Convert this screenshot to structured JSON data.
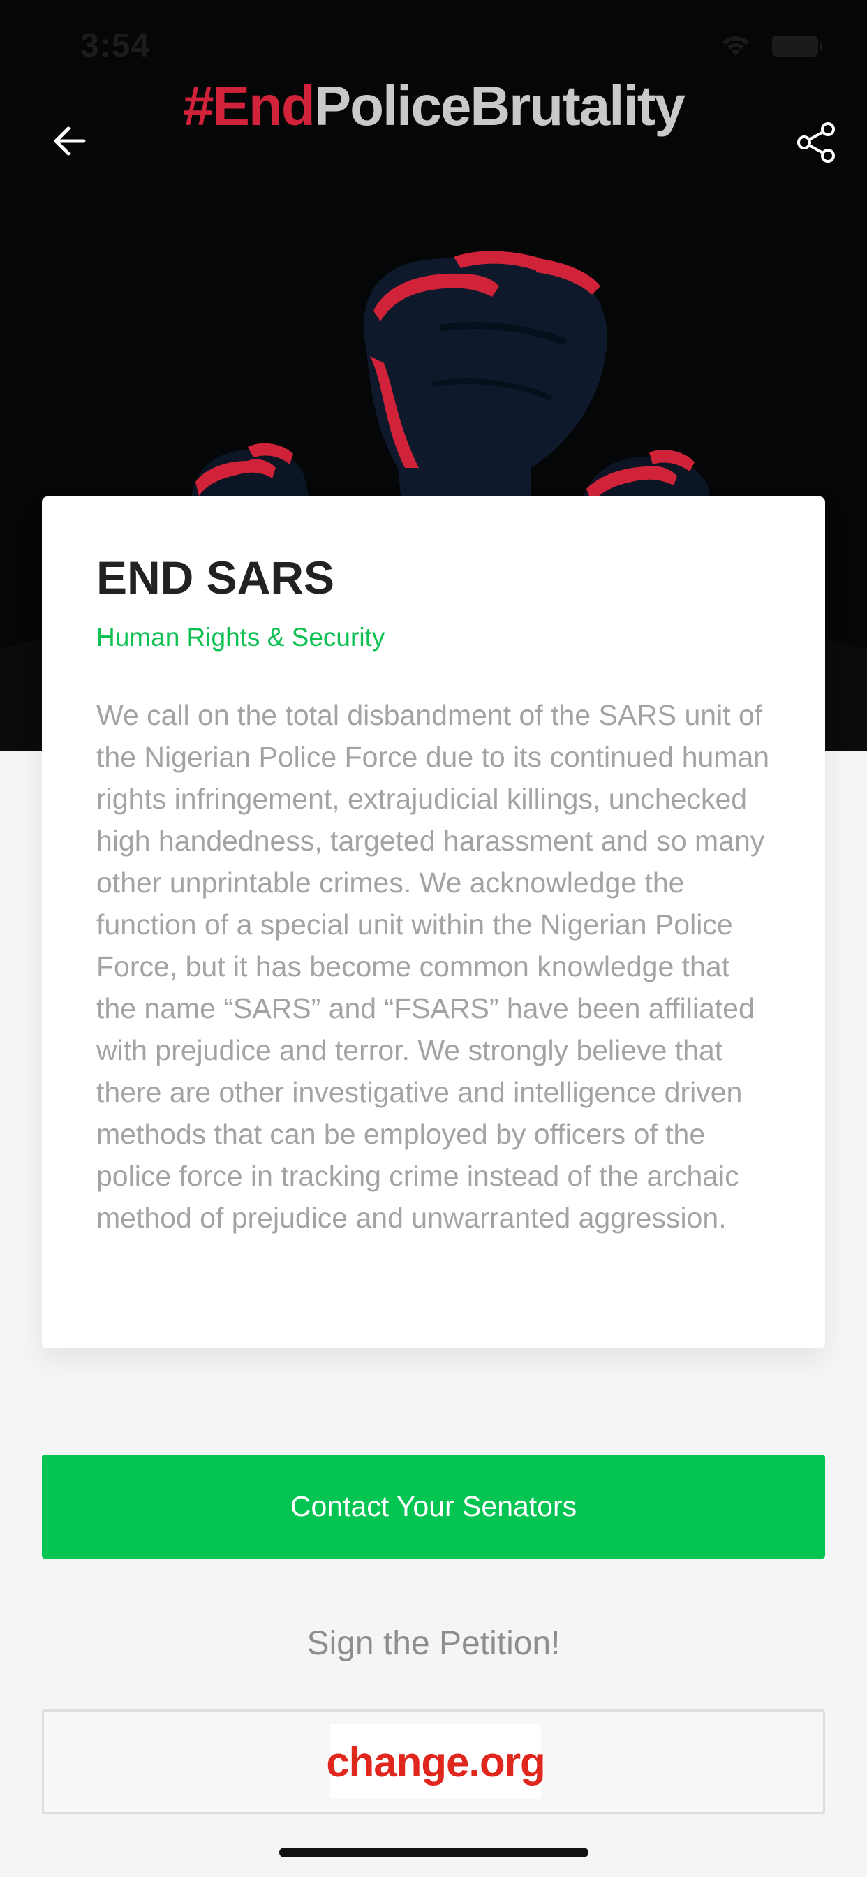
{
  "status_bar": {
    "time": "3:54"
  },
  "header": {
    "title_hash": "#End",
    "title_rest": "PoliceBrutality",
    "back_icon": "arrow-left-icon",
    "share_icon": "share-icon"
  },
  "card": {
    "title": "END SARS",
    "category": "Human Rights & Security",
    "body": "We call on the total disbandment of the SARS unit of the Nigerian Police Force due to its continued human rights infringement, extrajudicial killings, unchecked high handedness, targeted harassment and so many other unprintable crimes.  We acknowledge the function of a special unit within the Nigerian Police Force, but it has become common knowledge that the name “SARS” and “FSARS” have been affiliated with prejudice and terror.  We strongly believe that there are other investigative and intelligence driven methods that can be employed by officers of the police force in tracking crime instead of the archaic method of prejudice and unwarranted aggression."
  },
  "actions": {
    "contact_label": "Contact Your Senators",
    "petition_heading": "Sign the Petition!",
    "petition_logo": "change.org"
  },
  "colors": {
    "accent_green": "#05c552",
    "hashtag_red": "#d0233a",
    "change_red": "#e0271e"
  }
}
